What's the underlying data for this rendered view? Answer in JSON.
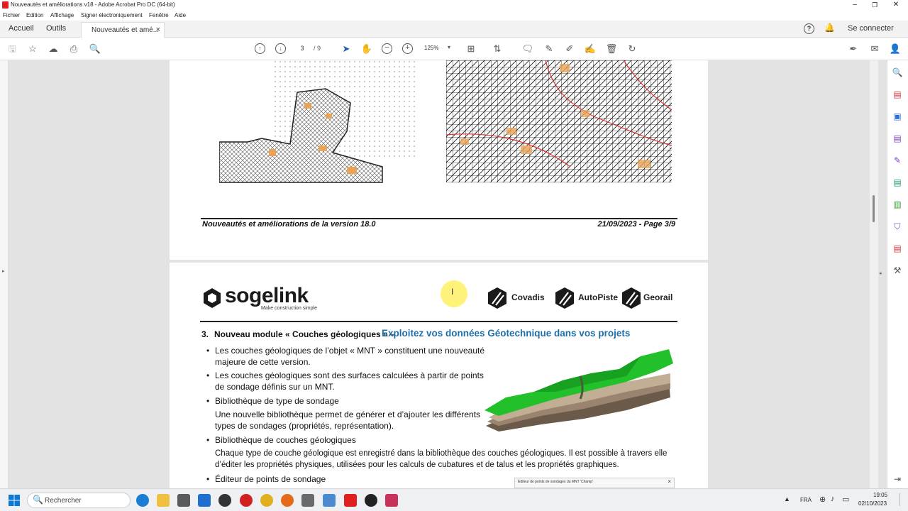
{
  "window": {
    "title": "Nouveautés et améliorations v18 - Adobe Acrobat Pro DC (64-bit)",
    "controls": [
      "–",
      "❐",
      "✕"
    ]
  },
  "menu": [
    "Fichier",
    "Edition",
    "Affichage",
    "Signer électroniquement",
    "Fenêtre",
    "Aide"
  ],
  "tabs": {
    "home": "Accueil",
    "tools": "Outils",
    "document": "Nouveautés et amé...",
    "close": "×"
  },
  "header_right": {
    "help": "?",
    "signin": "Se connecter"
  },
  "toolbar": {
    "page_current": "3",
    "page_sep": "/ 9",
    "zoom": "125%"
  },
  "page3": {
    "footer_left": "Nouveautés et améliorations de la version 18.0",
    "footer_right": "21/09/2023 - Page 3/9"
  },
  "page4": {
    "brand": "sogelink",
    "brand_tagline": "Make construction simple",
    "products": [
      "Covadis",
      "AutoPiste",
      "Georail"
    ],
    "section_number": "3.",
    "section_title": "Nouveau module « Couches géologiques » –",
    "section_subtitle": "Exploitez vos données Géotechnique dans vos projets",
    "bullets": [
      {
        "title": "Les couches géologiques de l’objet « MNT » constituent une nouveauté",
        "cont": "majeure de cette version."
      },
      {
        "title": "Les couches géologiques sont des surfaces calculées à partir de points",
        "cont": "de sondage définis sur un MNT."
      },
      {
        "title": "Bibliothèque de type de sondage",
        "cont": "Une nouvelle bibliothèque permet de générer et d’ajouter les différents",
        "cont2": "types de sondages (propriétés, représentation)."
      },
      {
        "title": "Bibliothèque de couches géologiques",
        "cont": "Chaque type de couche géologique est enregistré dans la bibliothèque des couches géologiques. Il est possible à travers elle",
        "cont2": "d’éditer les propriétés physiques, utilisées pour les calculs de cubatures et de talus et les propriétés graphiques."
      },
      {
        "title": "Éditeur de points de sondage"
      }
    ],
    "dialog_title": "Éditeur de points de sondages du MNT 'Champ'",
    "dialog_close": "×"
  },
  "taskbar": {
    "search": "Rechercher",
    "lang": "FRA",
    "time": "19:05",
    "date": "02/10/2023"
  },
  "colors": {
    "accent_blue": "#1f6fa8",
    "acrobat_red": "#e02020",
    "cursor_highlight": "#fff27a"
  }
}
